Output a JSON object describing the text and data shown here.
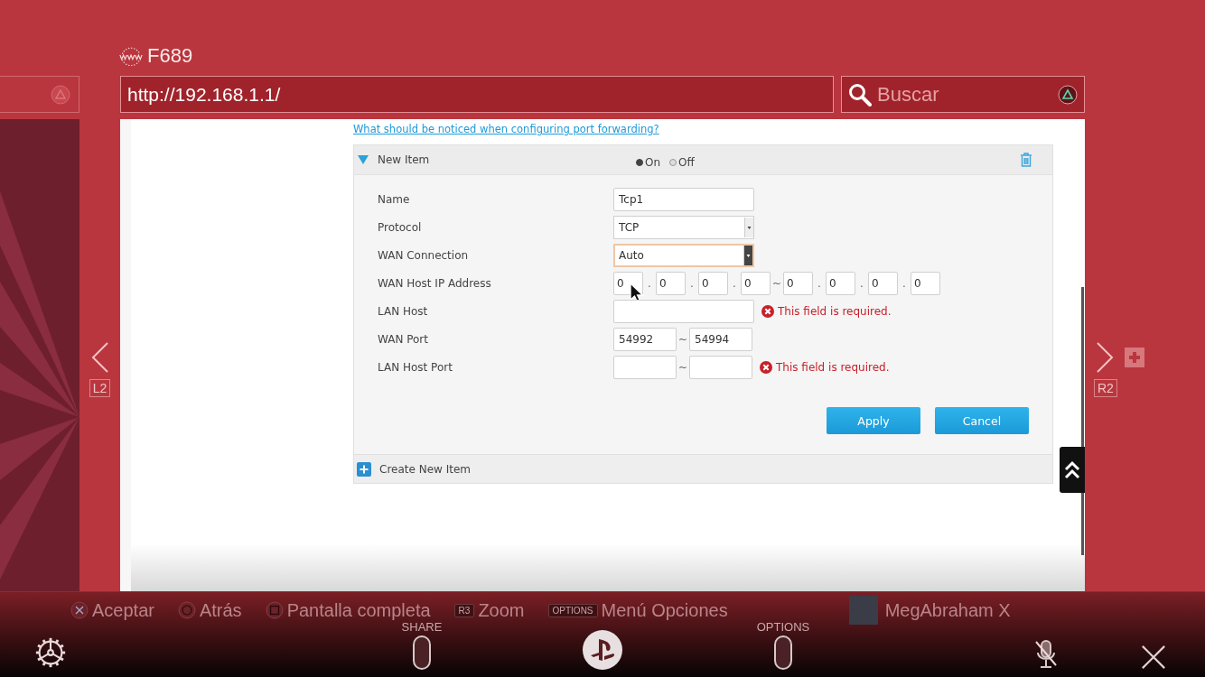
{
  "browser": {
    "tab_title": "F689",
    "url": "http://192.168.1.1/",
    "search": {
      "placeholder": "Buscar"
    }
  },
  "nav": {
    "prev_label": "L2",
    "next_label": "R2"
  },
  "page": {
    "help_link": "What should be noticed when configuring port forwarding?",
    "item": {
      "title": "New Item",
      "expanded": true,
      "switch": [
        {
          "label": "On",
          "selected": true
        },
        {
          "label": "Off",
          "selected": false
        }
      ],
      "fields": [
        {
          "kind": "text",
          "label": "Name",
          "value": "Tcp1"
        },
        {
          "kind": "select",
          "label": "Protocol",
          "value": "TCP",
          "focused": false
        },
        {
          "kind": "select",
          "label": "WAN Connection",
          "value": "Auto",
          "focused": true
        },
        {
          "kind": "ip_range",
          "label": "WAN Host IP Address",
          "start": [
            "0",
            "0",
            "0",
            "0"
          ],
          "end": [
            "0",
            "0",
            "0",
            "0"
          ],
          "dot": ".",
          "separator": "~"
        },
        {
          "kind": "text",
          "label": "LAN Host",
          "error": "This field is required."
        },
        {
          "kind": "port_range",
          "label": "WAN Port",
          "from": "54992",
          "to": "54994",
          "separator": "~"
        },
        {
          "kind": "port_range",
          "label": "LAN Host Port",
          "separator": "~",
          "error": "This field is required."
        }
      ],
      "buttons": [
        "Apply",
        "Cancel"
      ]
    },
    "create_label": "Create New Item"
  },
  "bottom_bar": {
    "hints": [
      {
        "kind": "cross",
        "label": "Aceptar"
      },
      {
        "kind": "circle",
        "label": "Atrás"
      },
      {
        "kind": "square",
        "label": "Pantalla completa"
      },
      {
        "kind": "badge",
        "badge": "R3",
        "label": "Zoom"
      },
      {
        "kind": "badge",
        "badge": "OPTIONS",
        "label": "Menú Opciones"
      }
    ],
    "user": {
      "name": "MegAbraham X"
    },
    "share_label": "SHARE",
    "options_label": "OPTIONS",
    "mic_muted": true
  }
}
